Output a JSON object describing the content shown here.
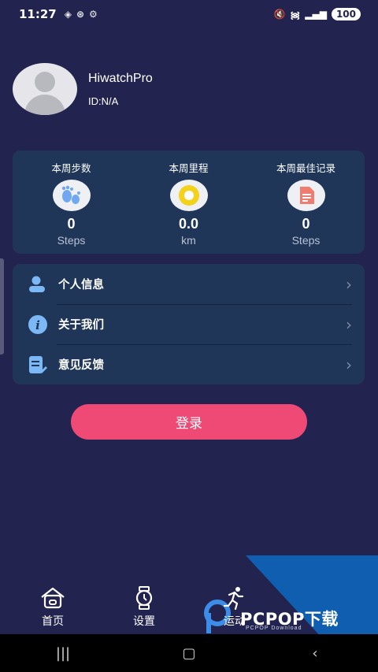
{
  "status_bar": {
    "time": "11:27",
    "battery": "100"
  },
  "profile": {
    "name": "HiwatchPro",
    "id": "ID:N/A"
  },
  "stats": [
    {
      "title": "本周步数",
      "value": "0",
      "unit": "Steps",
      "icon": "footprint-icon"
    },
    {
      "title": "本周里程",
      "value": "0.0",
      "unit": "km",
      "icon": "ring-icon"
    },
    {
      "title": "本周最佳记录",
      "value": "0",
      "unit": "Steps",
      "icon": "record-icon"
    }
  ],
  "menu": [
    {
      "label": "个人信息",
      "icon": "person-icon"
    },
    {
      "label": "关于我们",
      "icon": "info-icon"
    },
    {
      "label": "意见反馈",
      "icon": "feedback-icon"
    }
  ],
  "login_label": "登录",
  "tabs": [
    {
      "label": "首页",
      "icon": "home-icon"
    },
    {
      "label": "设置",
      "icon": "watch-icon"
    },
    {
      "label": "运动",
      "icon": "run-icon"
    }
  ],
  "watermark": {
    "text": "PCPOP下载",
    "sub": "PCPOP Download"
  },
  "colors": {
    "background": "#23234f",
    "card": "#1f3659",
    "login": "#ef4a76"
  }
}
